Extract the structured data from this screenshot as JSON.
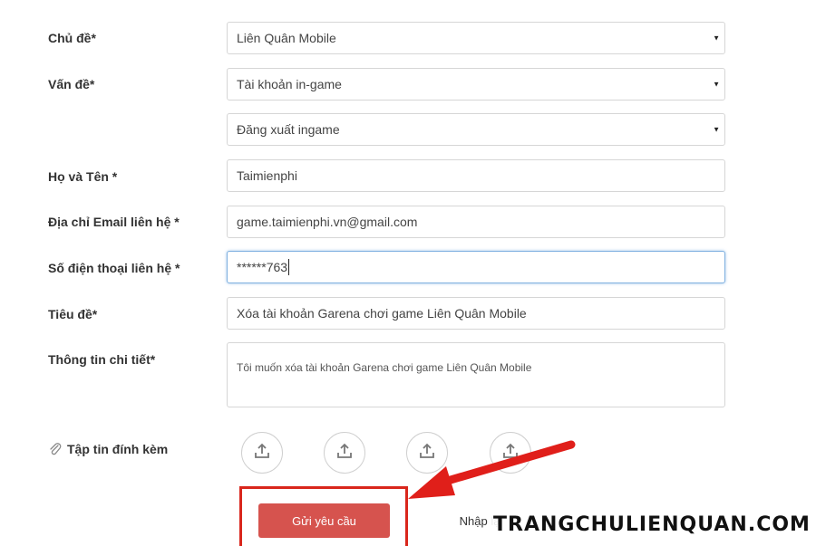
{
  "form": {
    "topic_label": "Chủ đề*",
    "topic_value": "Liên Quân Mobile",
    "issue_label": "Vấn đề*",
    "issue_value": "Tài khoản in-game",
    "subissue_value": "Đăng xuất ingame",
    "name_label": "Họ và Tên *",
    "name_value": "Taimienphi",
    "email_label": "Địa chỉ Email liên hệ *",
    "email_value": "game.taimienphi.vn@gmail.com",
    "phone_label": "Số điện thoại liên hệ *",
    "phone_value": "******763",
    "subject_label": "Tiêu đề*",
    "subject_value": "Xóa tài khoản Garena chơi game Liên Quân Mobile",
    "detail_label": "Thông tin chi tiết*",
    "detail_value": "Tôi muốn xóa tài khoản Garena chơi game Liên Quân Mobile",
    "attachment_label": "Tập tin đính kèm",
    "submit_label": "Gửi yêu cầu",
    "reset_label": "Nhập lại"
  },
  "watermark": "TRANGCHULIENQUAN.COM",
  "colors": {
    "submit": "#d6534e",
    "highlight": "#d9261c"
  },
  "icons": {
    "attachment": "paperclip-icon",
    "upload": "upload-icon",
    "dropdown": "dropdown-caret-icon"
  }
}
